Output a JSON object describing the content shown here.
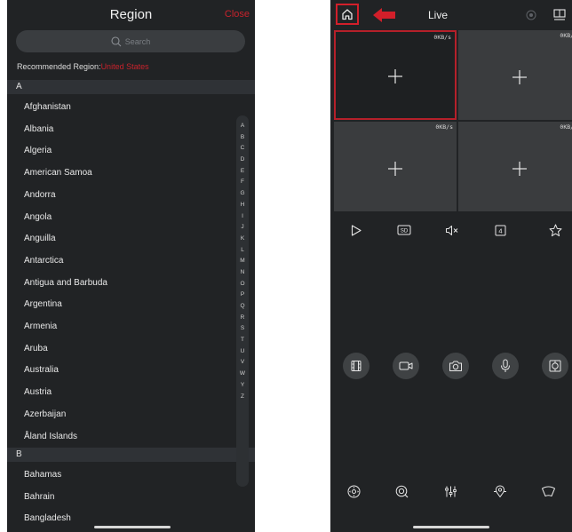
{
  "region_screen": {
    "title": "Region",
    "close_label": "Close",
    "search_placeholder": "Search",
    "recommended_label": "Recommended Region:",
    "recommended_country": "United States",
    "section_a": "A",
    "section_b": "B",
    "countries_a": [
      "Afghanistan",
      "Albania",
      "Algeria",
      "American Samoa",
      "Andorra",
      "Angola",
      "Anguilla",
      "Antarctica",
      "Antigua and Barbuda",
      "Argentina",
      "Armenia",
      "Aruba",
      "Australia",
      "Austria",
      "Azerbaijan",
      "Åland Islands"
    ],
    "countries_b": [
      "Bahamas",
      "Bahrain",
      "Bangladesh"
    ],
    "index_letters": [
      "A",
      "B",
      "C",
      "D",
      "E",
      "F",
      "G",
      "H",
      "I",
      "J",
      "K",
      "L",
      "M",
      "N",
      "O",
      "P",
      "Q",
      "R",
      "S",
      "T",
      "U",
      "V",
      "W",
      "Y",
      "Z"
    ]
  },
  "live_screen": {
    "title": "Live",
    "tiles": [
      {
        "rate": "0KB/s",
        "selected": true
      },
      {
        "rate": "0KB/s",
        "selected": false
      },
      {
        "rate": "0KB/s",
        "selected": false
      },
      {
        "rate": "0KB/s",
        "selected": false
      }
    ],
    "sd_label": "SD",
    "split_label": "4",
    "controls": [
      "play-icon",
      "sd-quality-icon",
      "mute-icon",
      "split-screen-icon",
      "favorite-star-icon"
    ],
    "tools": [
      "playback-film-icon",
      "record-video-icon",
      "snapshot-camera-icon",
      "talk-microphone-icon",
      "fisheye-icon"
    ],
    "ptz_tools": [
      "ptz-direction-icon",
      "zoom-lens-icon",
      "image-adjust-icon",
      "preset-icon",
      "wiper-icon"
    ],
    "highlight_color": "#d21f2a",
    "accent_red": "#c8232c"
  }
}
